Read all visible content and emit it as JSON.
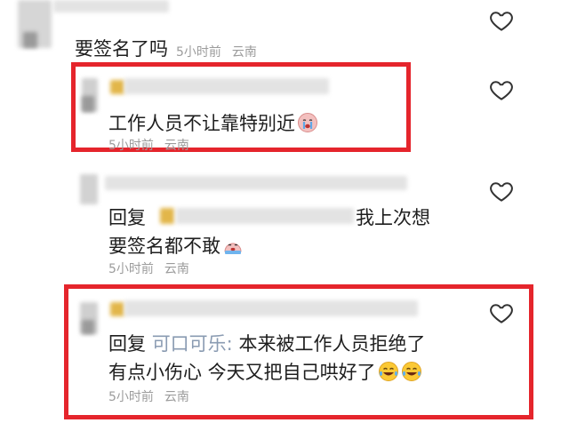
{
  "comments": [
    {
      "text": "要签名了吗",
      "time": "5小时前",
      "location": "云南",
      "like_icon": "heart-outline-icon"
    },
    {
      "text": "工作人员不让靠特别近",
      "emoji": "crying-face-icon",
      "time": "5小时前",
      "location": "云南",
      "like_icon": "heart-outline-icon"
    },
    {
      "reply_prefix": "回复",
      "text_line1": "我上次想",
      "text_line2": "要签名都不敢",
      "emoji": "crying-face-icon",
      "time": "5小时前",
      "location": "云南",
      "like_icon": "heart-outline-icon"
    },
    {
      "reply_prefix": "回复",
      "reply_to": "可口可乐:",
      "text_line1": "本来被工作人员拒绝了",
      "text_line2": "有点小伤心 今天又把自己哄好了",
      "emoji": "tears-of-joy-icon",
      "time": "5小时前",
      "location": "云南",
      "like_icon": "heart-outline-icon"
    }
  ],
  "colors": {
    "highlight_border": "#e5252c",
    "meta_text": "#9c9c9c",
    "reply_name": "#8a9bb2"
  }
}
